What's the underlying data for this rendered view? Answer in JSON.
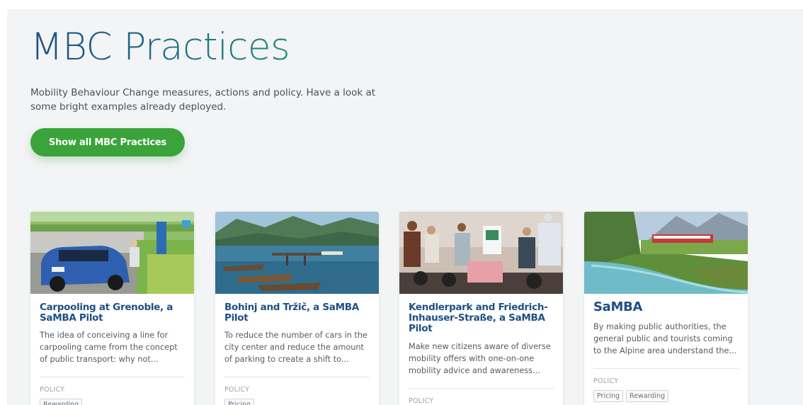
{
  "header": {
    "title": "MBC Practices",
    "subtitle": "Mobility Behaviour Change measures, actions and policy. Have a look at some bright examples already deployed.",
    "cta_label": "Show all MBC Practices"
  },
  "cards": [
    {
      "title": "Carpooling at Grenoble, a SaMBA Pilot",
      "description": "The idea of conceiving a line for carpooling came from the concept of public transport: why not...",
      "category": "POLICY",
      "tags": [
        "Rewarding"
      ]
    },
    {
      "title": "Bohinj and Tržič, a SaMBA Pilot",
      "description": "To reduce the number of cars in the city center and reduce the amount of parking to create a shift to...",
      "category": "POLICY",
      "tags": [
        "Pricing"
      ]
    },
    {
      "title": "Kendlerpark and Friedrich-Inhauser-Straße, a SaMBA Pilot",
      "description": "Make new citizens aware of diverse mobility offers with one-on-one mobility advice and awareness...",
      "category": "POLICY",
      "tags": []
    },
    {
      "title": "SaMBA",
      "description": "By making public authorities, the general public and tourists coming to the Alpine area understand the...",
      "category": "POLICY",
      "tags": [
        "Pricing",
        "Rewarding"
      ]
    }
  ],
  "colors": {
    "title_blue": "#1f4f83",
    "cta_green": "#3aa43a",
    "card_title": "#1f4f83",
    "panel_bg": "#f3f4f5"
  }
}
